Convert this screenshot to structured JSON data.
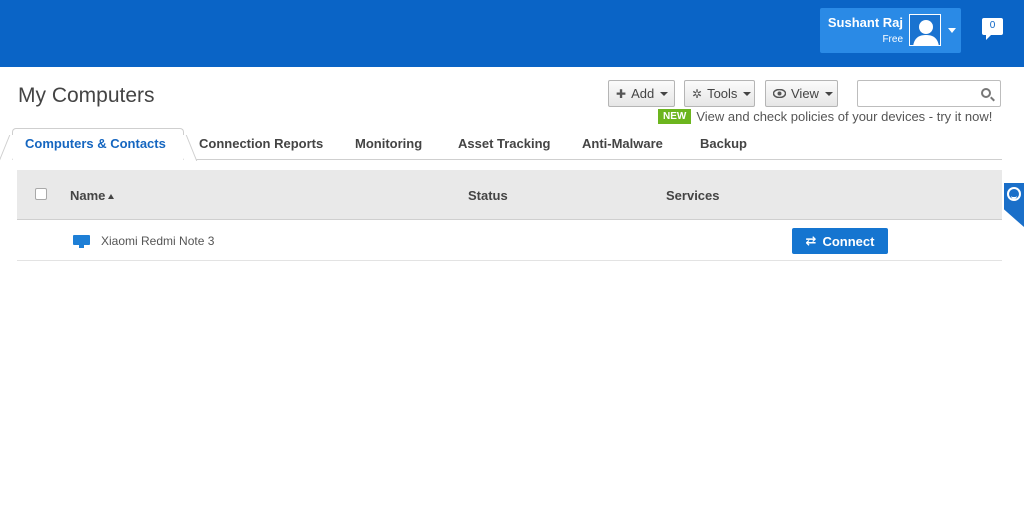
{
  "header": {
    "user": {
      "name": "Sushant Raj",
      "plan": "Free"
    },
    "notifications": {
      "count": "0"
    },
    "colors": {
      "brand": "#0a64c6",
      "user_box": "#2a8ae6"
    }
  },
  "page": {
    "title": "My Computers"
  },
  "toolbar": {
    "add_label": "Add",
    "tools_label": "Tools",
    "view_label": "View",
    "search_placeholder": "",
    "add_icon": "plus-icon",
    "tools_icon": "gear-icon",
    "view_icon": "eye-icon"
  },
  "promo": {
    "badge": "NEW",
    "text": "View and check policies of your devices - try it now!",
    "badge_color": "#6cb51e"
  },
  "tabs": [
    {
      "label": "Computers & Contacts",
      "active": true
    },
    {
      "label": "Connection Reports",
      "active": false
    },
    {
      "label": "Monitoring",
      "active": false
    },
    {
      "label": "Asset Tracking",
      "active": false
    },
    {
      "label": "Anti-Malware",
      "active": false
    },
    {
      "label": "Backup",
      "active": false
    }
  ],
  "table": {
    "columns": {
      "name": "Name",
      "status": "Status",
      "services": "Services"
    },
    "rows": [
      {
        "name": "Xiaomi Redmi Note 3",
        "status": "",
        "action": "Connect",
        "icon": "monitor-icon"
      }
    ]
  }
}
